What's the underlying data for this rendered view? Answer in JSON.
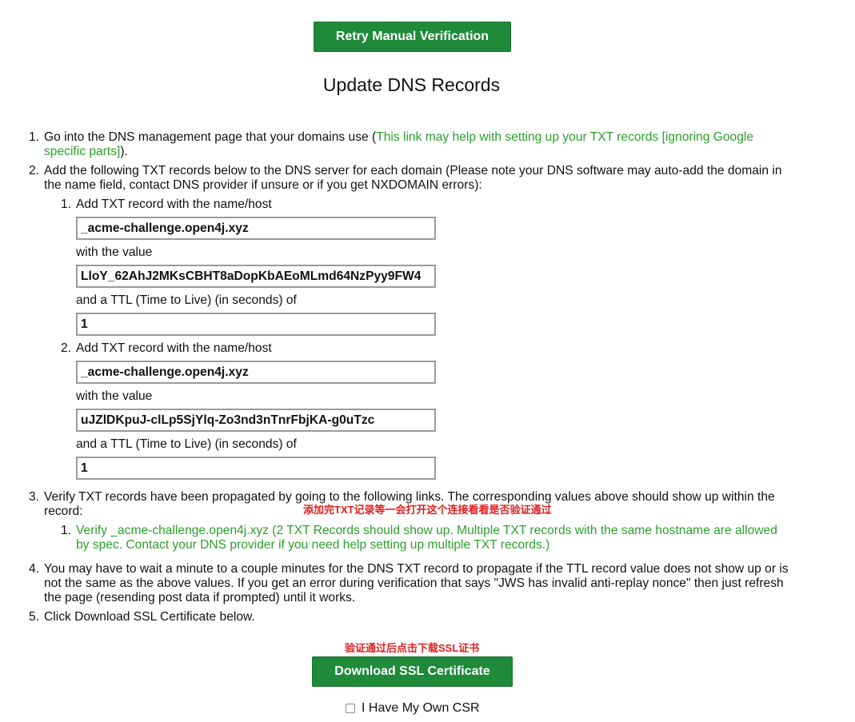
{
  "retry_button": "Retry Manual Verification",
  "title": "Update DNS Records",
  "steps": {
    "s1_num": "1.",
    "s1_text": "Go into the DNS management page that your domains use (",
    "s1_link_a": "This link may help with setting up your TXT records [ignoring Google",
    "s1_link_b": "specific parts]",
    "s1_end": ").",
    "s2_num": "2.",
    "s2_line1": "Add the following TXT records below to the DNS server for each domain (Please note your DNS software may auto-add the domain in",
    "s2_line2": "the name field, contact DNS provider if unsure or if you get NXDOMAIN errors):",
    "s3_num": "3.",
    "s3_line1": "Verify TXT records have been propagated by going to the following links. The corresponding values above should show up within the",
    "s3_line2": "record:",
    "s4_num": "4.",
    "s4_line1": "You may have to wait a minute to a couple minutes for the DNS TXT record to propagate if the TTL record value does not show up or is",
    "s4_line2": "not the same as the above values. If you get an error during verification that says \"JWS has invalid anti-replay nonce\" then just refresh",
    "s4_line3": "the page (resending post data if prompted) until it works.",
    "s5_num": "5.",
    "s5_text": "Click Download SSL Certificate below."
  },
  "records": [
    {
      "num": "1.",
      "name_label": "Add TXT record with the name/host",
      "name": "_acme-challenge.open4j.xyz",
      "value_label": "with the value",
      "value": "LloY_62AhJ2MKsCBHT8aDopKbAEoMLmd64NzPyy9FW4",
      "ttl_label": "and a TTL (Time to Live) (in seconds) of",
      "ttl": "1"
    },
    {
      "num": "2.",
      "name_label": "Add TXT record with the name/host",
      "name": "_acme-challenge.open4j.xyz",
      "value_label": "with the value",
      "value": "uJZlDKpuJ-clLp5SjYlq-Zo3nd3nTnrFbjKA-g0uTzc",
      "ttl_label": "and a TTL (Time to Live) (in seconds) of",
      "ttl": "1"
    }
  ],
  "verify_link": {
    "num": "1.",
    "line1": "Verify _acme-challenge.open4j.xyz (2 TXT Records should show up. Multiple TXT records with the same hostname are allowed",
    "line2": "by spec. Contact your DNS provider if you need help setting up multiple TXT records.)"
  },
  "annotations": {
    "verify_note": "添加完TXT记录等一会打开这个连接看看是否验证通过",
    "download_note": "验证通过后点击下载SSL证书"
  },
  "download_button": "Download SSL Certificate",
  "own_csr_label": "I Have My Own CSR",
  "own_csr_checked": false,
  "colors": {
    "button_green": "#1f8a3a",
    "link_green": "#2ba02b",
    "annotation_red": "#e02020"
  }
}
